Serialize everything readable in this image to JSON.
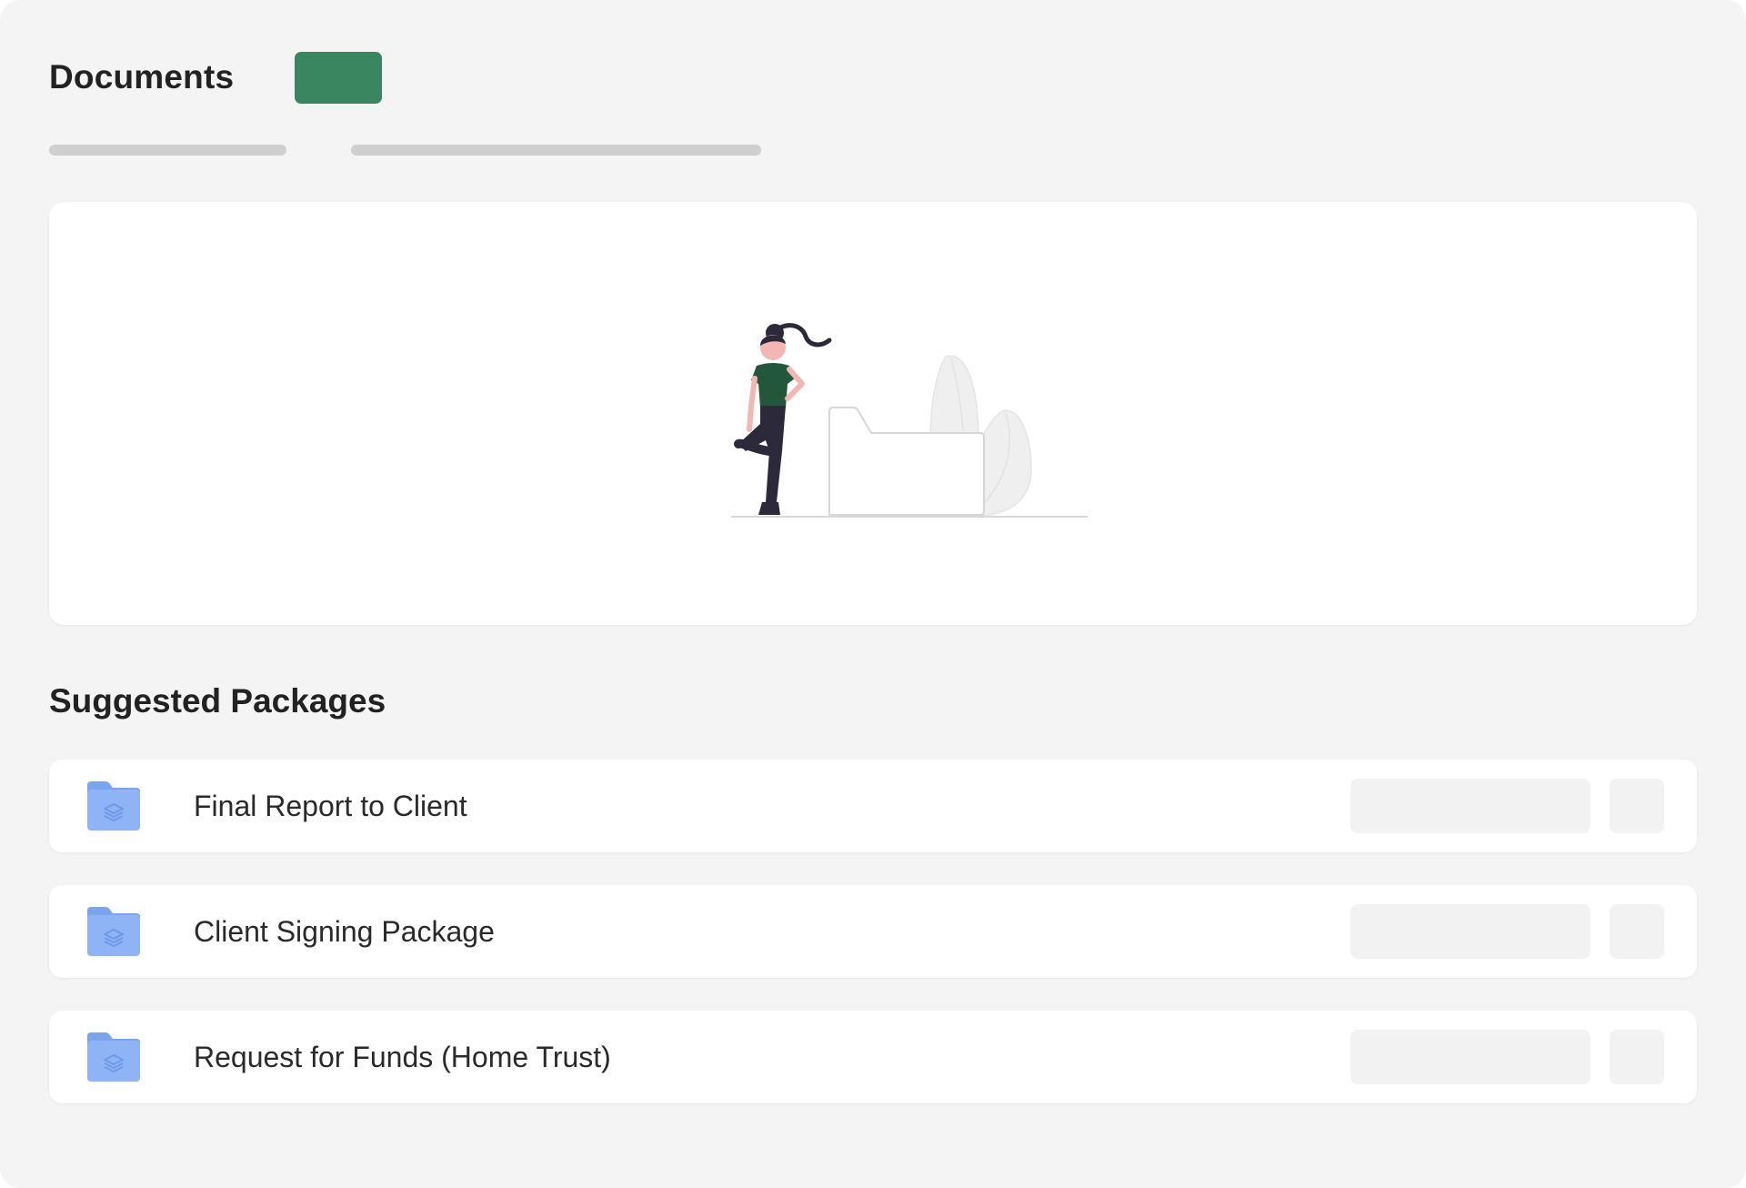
{
  "header": {
    "title": "Documents"
  },
  "empty_state": {
    "illustration": "person-leaning-on-folder-illustration"
  },
  "suggested": {
    "title": "Suggested Packages",
    "packages": [
      {
        "name": "Final Report to Client",
        "icon": "folder-stack-icon"
      },
      {
        "name": "Client Signing Package",
        "icon": "folder-stack-icon"
      },
      {
        "name": "Request for Funds (Home Trust)",
        "icon": "folder-stack-icon"
      }
    ]
  },
  "colors": {
    "primary": "#3a8661",
    "folder": "#8fb4f5",
    "panel_background": "#f4f4f4",
    "skeleton": "#cfcfcf"
  }
}
